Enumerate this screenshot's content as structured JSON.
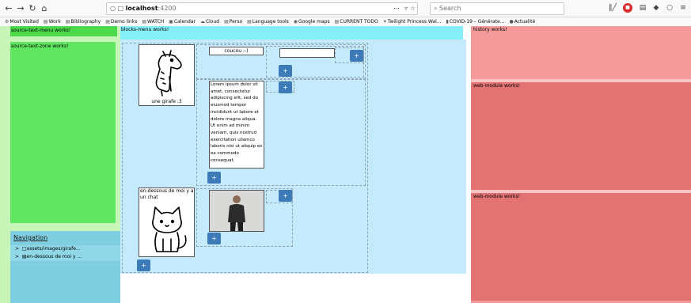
{
  "browser": {
    "url_host": "localhost",
    "url_port": ":4200",
    "search_placeholder": "Search",
    "url_more": "⋯",
    "bookmarks": [
      {
        "icon": "⚙",
        "label": "Most Visited"
      },
      {
        "icon": "▤",
        "label": "Work"
      },
      {
        "icon": "▤",
        "label": "Bibliography"
      },
      {
        "icon": "▤",
        "label": "Demo links"
      },
      {
        "icon": "▤",
        "label": "WATCH"
      },
      {
        "icon": "▣",
        "label": "Calendar"
      },
      {
        "icon": "☁",
        "label": "Cloud"
      },
      {
        "icon": "▤",
        "label": "Perso"
      },
      {
        "icon": "▤",
        "label": "Language tools"
      },
      {
        "icon": "◉",
        "label": "Google maps"
      },
      {
        "icon": "▤",
        "label": "CURRENT TODO"
      },
      {
        "icon": "✦",
        "label": "Twilight Princess Wal..."
      },
      {
        "icon": "▮",
        "label": "COVID-19 – Générate..."
      },
      {
        "icon": "●",
        "label": "Actualité"
      }
    ]
  },
  "app": {
    "source_menu_label": "source-text-menu works!",
    "source_zone_label": "source-text-zone works!",
    "blocks_menu_label": "blocks-menu works!",
    "history_label": "history works!",
    "web_module_1_label": "web-module works!",
    "web_module_2_label": "web-module works!",
    "navigation_title": "Navigation",
    "nav_items": [
      {
        "arrow": ">",
        "label": "□assets/images/girafe..."
      },
      {
        "arrow": ">",
        "label": "▤en-dessous de moi y ..."
      }
    ],
    "giraffe_caption": "une girafe :3",
    "coucou_text": "coucou :-)",
    "lorem_text": "Lorem ipsum dolor sit amet, consectetur adipiscing elit, sed do eiusmod tempor incididunt ut labore et dolore magna aliqua. Ut enim ad minim veniam, quis nostrud exercitation ullamco laboris nisi ut aliquip ex ea commodo consequat.",
    "cat_caption": "en-dessous de moi y a un chat",
    "add_label": "+"
  }
}
